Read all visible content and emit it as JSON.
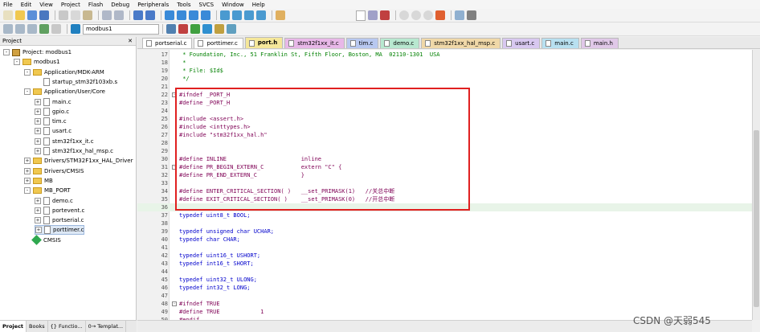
{
  "menu": [
    "File",
    "Edit",
    "View",
    "Project",
    "Flash",
    "Debug",
    "Peripherals",
    "Tools",
    "SVCS",
    "Window",
    "Help"
  ],
  "toolbar": {
    "target": "modbus1"
  },
  "project_panel": {
    "title": "Project",
    "controls": "✕",
    "tree": [
      {
        "label": "Project: modbus1",
        "kind": "proj",
        "depth": 0,
        "exp": "-"
      },
      {
        "label": "modbus1",
        "kind": "folder",
        "depth": 1,
        "exp": "-"
      },
      {
        "label": "Application/MDK-ARM",
        "kind": "folder",
        "depth": 2,
        "exp": "-"
      },
      {
        "label": "startup_stm32f103xb.s",
        "kind": "file",
        "depth": 3,
        "exp": ""
      },
      {
        "label": "Application/User/Core",
        "kind": "folder",
        "depth": 2,
        "exp": "-"
      },
      {
        "label": "main.c",
        "kind": "file",
        "depth": 3,
        "exp": "+"
      },
      {
        "label": "gpio.c",
        "kind": "file",
        "depth": 3,
        "exp": "+"
      },
      {
        "label": "tim.c",
        "kind": "file",
        "depth": 3,
        "exp": "+"
      },
      {
        "label": "usart.c",
        "kind": "file",
        "depth": 3,
        "exp": "+"
      },
      {
        "label": "stm32f1xx_it.c",
        "kind": "file",
        "depth": 3,
        "exp": "+"
      },
      {
        "label": "stm32f1xx_hal_msp.c",
        "kind": "file",
        "depth": 3,
        "exp": "+"
      },
      {
        "label": "Drivers/STM32F1xx_HAL_Driver",
        "kind": "folder",
        "depth": 2,
        "exp": "+"
      },
      {
        "label": "Drivers/CMSIS",
        "kind": "folder",
        "depth": 2,
        "exp": "+"
      },
      {
        "label": "MB",
        "kind": "folder",
        "depth": 2,
        "exp": "+"
      },
      {
        "label": "MB_PORT",
        "kind": "folder",
        "depth": 2,
        "exp": "-"
      },
      {
        "label": "demo.c",
        "kind": "file",
        "depth": 3,
        "exp": "+"
      },
      {
        "label": "portevent.c",
        "kind": "file",
        "depth": 3,
        "exp": "+"
      },
      {
        "label": "portserial.c",
        "kind": "file",
        "depth": 3,
        "exp": "+"
      },
      {
        "label": "porttimer.c",
        "kind": "file",
        "depth": 3,
        "exp": "+",
        "selected": true
      },
      {
        "label": "CMSIS",
        "kind": "comp",
        "depth": 2,
        "exp": ""
      }
    ]
  },
  "bottom_tabs": [
    "Project",
    "Books",
    "{} Functio...",
    "0→ Templat..."
  ],
  "editor_tabs": [
    {
      "label": "portserial.c",
      "color": "#ffffff"
    },
    {
      "label": "porttimer.c",
      "color": "#ffffff"
    },
    {
      "label": "port.h",
      "color": "#f5e79a",
      "active": true
    },
    {
      "label": "stm32f1xx_it.c",
      "color": "#e8b8e8"
    },
    {
      "label": "tim.c",
      "color": "#b8c8f0"
    },
    {
      "label": "demo.c",
      "color": "#b8e8d0"
    },
    {
      "label": "stm32f1xx_hal_msp.c",
      "color": "#f0d8a8"
    },
    {
      "label": "usart.c",
      "color": "#d8c8f0"
    },
    {
      "label": "main.c",
      "color": "#b8e0f0"
    },
    {
      "label": "main.h",
      "color": "#e0c8e8"
    }
  ],
  "code": [
    {
      "n": "17",
      "t": " * Foundation, Inc., 51 Franklin St, Fifth Floor, Boston, MA  02110-1301  USA",
      "c": "cm"
    },
    {
      "n": "18",
      "t": " *",
      "c": "cm"
    },
    {
      "n": "19",
      "t": " * File: $Id$",
      "c": "cm"
    },
    {
      "n": "20",
      "t": " */",
      "c": "cm"
    },
    {
      "n": "21",
      "t": "",
      "c": ""
    },
    {
      "n": "22",
      "t": "#ifndef _PORT_H",
      "c": "pp",
      "fold": true
    },
    {
      "n": "23",
      "t": "#define _PORT_H",
      "c": "pp"
    },
    {
      "n": "24",
      "t": "",
      "c": ""
    },
    {
      "n": "25",
      "t": "#include <assert.h>",
      "c": "pp"
    },
    {
      "n": "26",
      "t": "#include <inttypes.h>",
      "c": "pp"
    },
    {
      "n": "27",
      "t": "#include \"stm32f1xx_hal.h\"",
      "c": "pp"
    },
    {
      "n": "28",
      "t": "",
      "c": ""
    },
    {
      "n": "29",
      "t": "",
      "c": ""
    },
    {
      "n": "30",
      "t": "#define INLINE                      inline",
      "c": "pp"
    },
    {
      "n": "31",
      "t": "#define PR_BEGIN_EXTERN_C           extern \"C\" {",
      "c": "pp",
      "fold": true
    },
    {
      "n": "32",
      "t": "#define PR_END_EXTERN_C             }",
      "c": "pp"
    },
    {
      "n": "33",
      "t": "",
      "c": ""
    },
    {
      "n": "34",
      "t": "#define ENTER_CRITICAL_SECTION( )   __set_PRIMASK(1)   //关总中断",
      "c": "pp"
    },
    {
      "n": "35",
      "t": "#define EXIT_CRITICAL_SECTION( )    __set_PRIMASK(0)   //开总中断",
      "c": "pp"
    },
    {
      "n": "36",
      "t": "",
      "c": "",
      "current": true
    },
    {
      "n": "37",
      "t": "typedef uint8_t BOOL;",
      "c": "kw"
    },
    {
      "n": "38",
      "t": "",
      "c": ""
    },
    {
      "n": "39",
      "t": "typedef unsigned char UCHAR;",
      "c": "kw"
    },
    {
      "n": "40",
      "t": "typedef char CHAR;",
      "c": "kw"
    },
    {
      "n": "41",
      "t": "",
      "c": ""
    },
    {
      "n": "42",
      "t": "typedef uint16_t USHORT;",
      "c": "kw"
    },
    {
      "n": "43",
      "t": "typedef int16_t SHORT;",
      "c": "kw"
    },
    {
      "n": "44",
      "t": "",
      "c": ""
    },
    {
      "n": "45",
      "t": "typedef uint32_t ULONG;",
      "c": "kw"
    },
    {
      "n": "46",
      "t": "typedef int32_t LONG;",
      "c": "kw"
    },
    {
      "n": "47",
      "t": "",
      "c": ""
    },
    {
      "n": "48",
      "t": "#ifndef TRUE",
      "c": "pp",
      "fold": true
    },
    {
      "n": "49",
      "t": "#define TRUE            1",
      "c": "pp"
    },
    {
      "n": "50",
      "t": "#endif",
      "c": "pp"
    }
  ],
  "watermark": "CSDN @天弱545"
}
